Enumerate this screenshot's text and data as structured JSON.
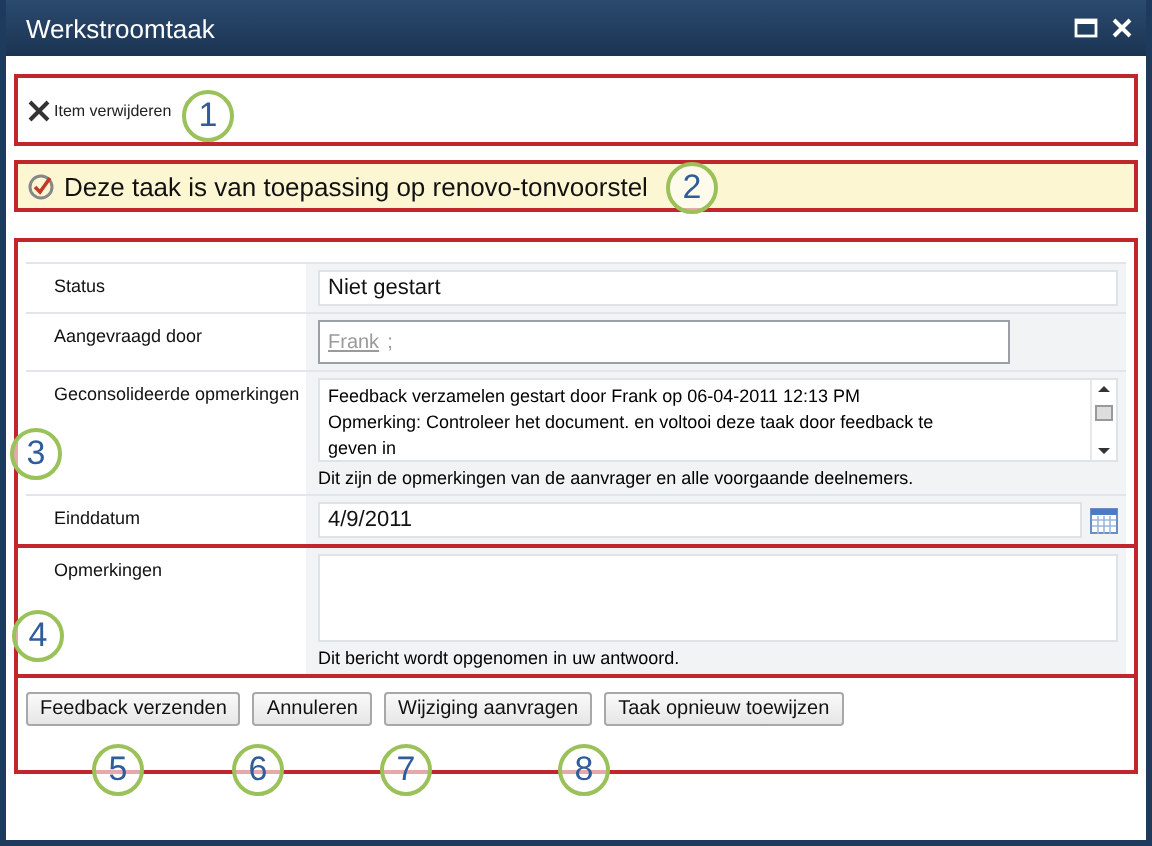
{
  "window": {
    "title": "Werkstroomtaak"
  },
  "toolbar": {
    "delete_label": "Item verwijderen"
  },
  "notice": "Deze taak is van toepassing op renovo-tonvoorstel",
  "fields": [
    {
      "kind": "text",
      "label": "Status",
      "value": "Niet gestart"
    },
    {
      "kind": "people",
      "label": "Aangevraagd door",
      "value": "Frank",
      "separator": ";"
    },
    {
      "kind": "comments",
      "label": "Geconsolideerde opmerkingen",
      "lines": [
        "Feedback verzamelen gestart door Frank op 06-04-2011 12:13 PM",
        "Opmerking: Controleer het document. en voltooi deze taak door feedback te",
        "geven in"
      ],
      "hint": "Dit zijn de opmerkingen van de aanvrager en alle voorgaande deelnemers."
    },
    {
      "kind": "date",
      "label": "Einddatum",
      "value": "4/9/2011"
    }
  ],
  "response": {
    "label": "Opmerkingen",
    "hint": "Dit bericht wordt opgenomen in uw antwoord."
  },
  "buttons": [
    "Feedback verzenden",
    "Annuleren",
    "Wijziging aanvragen",
    "Taak opnieuw toewijzen"
  ],
  "callouts": [
    "1",
    "2",
    "3",
    "4",
    "5",
    "6",
    "7",
    "8"
  ]
}
